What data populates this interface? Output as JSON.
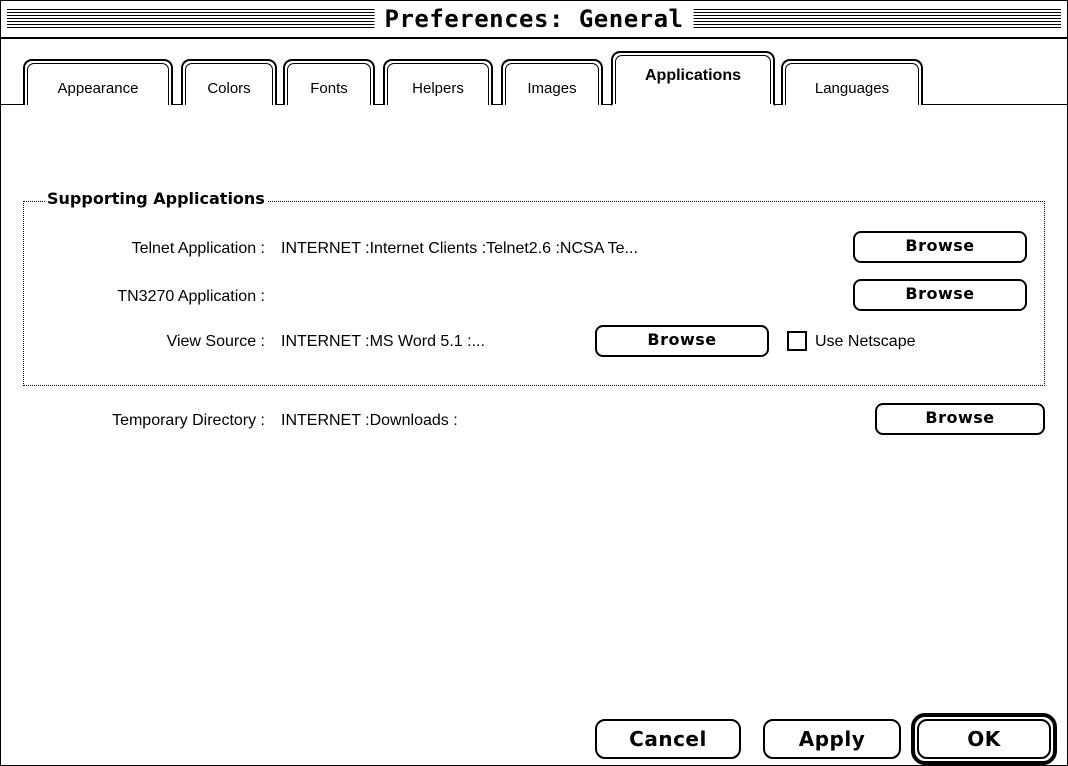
{
  "window": {
    "title": "Preferences: General"
  },
  "tabs": [
    {
      "label": "Appearance"
    },
    {
      "label": "Colors"
    },
    {
      "label": "Fonts"
    },
    {
      "label": "Helpers"
    },
    {
      "label": "Images"
    },
    {
      "label": "Applications",
      "active": true
    },
    {
      "label": "Languages"
    }
  ],
  "supporting": {
    "title": "Supporting Applications",
    "telnet": {
      "label": "Telnet Application :",
      "value": "INTERNET :Internet Clients :Telnet2.6 :NCSA Te...",
      "button": "Browse"
    },
    "tn3270": {
      "label": "TN3270 Application :",
      "value": "",
      "button": "Browse"
    },
    "view_source": {
      "label": "View Source :",
      "value": "INTERNET :MS Word 5.1 :...",
      "button": "Browse",
      "checkbox_label": "Use Netscape",
      "checked": false
    }
  },
  "temp_dir": {
    "label": "Temporary Directory :",
    "value": "INTERNET :Downloads :",
    "button": "Browse"
  },
  "footer": {
    "cancel": "Cancel",
    "apply": "Apply",
    "ok": "OK"
  }
}
